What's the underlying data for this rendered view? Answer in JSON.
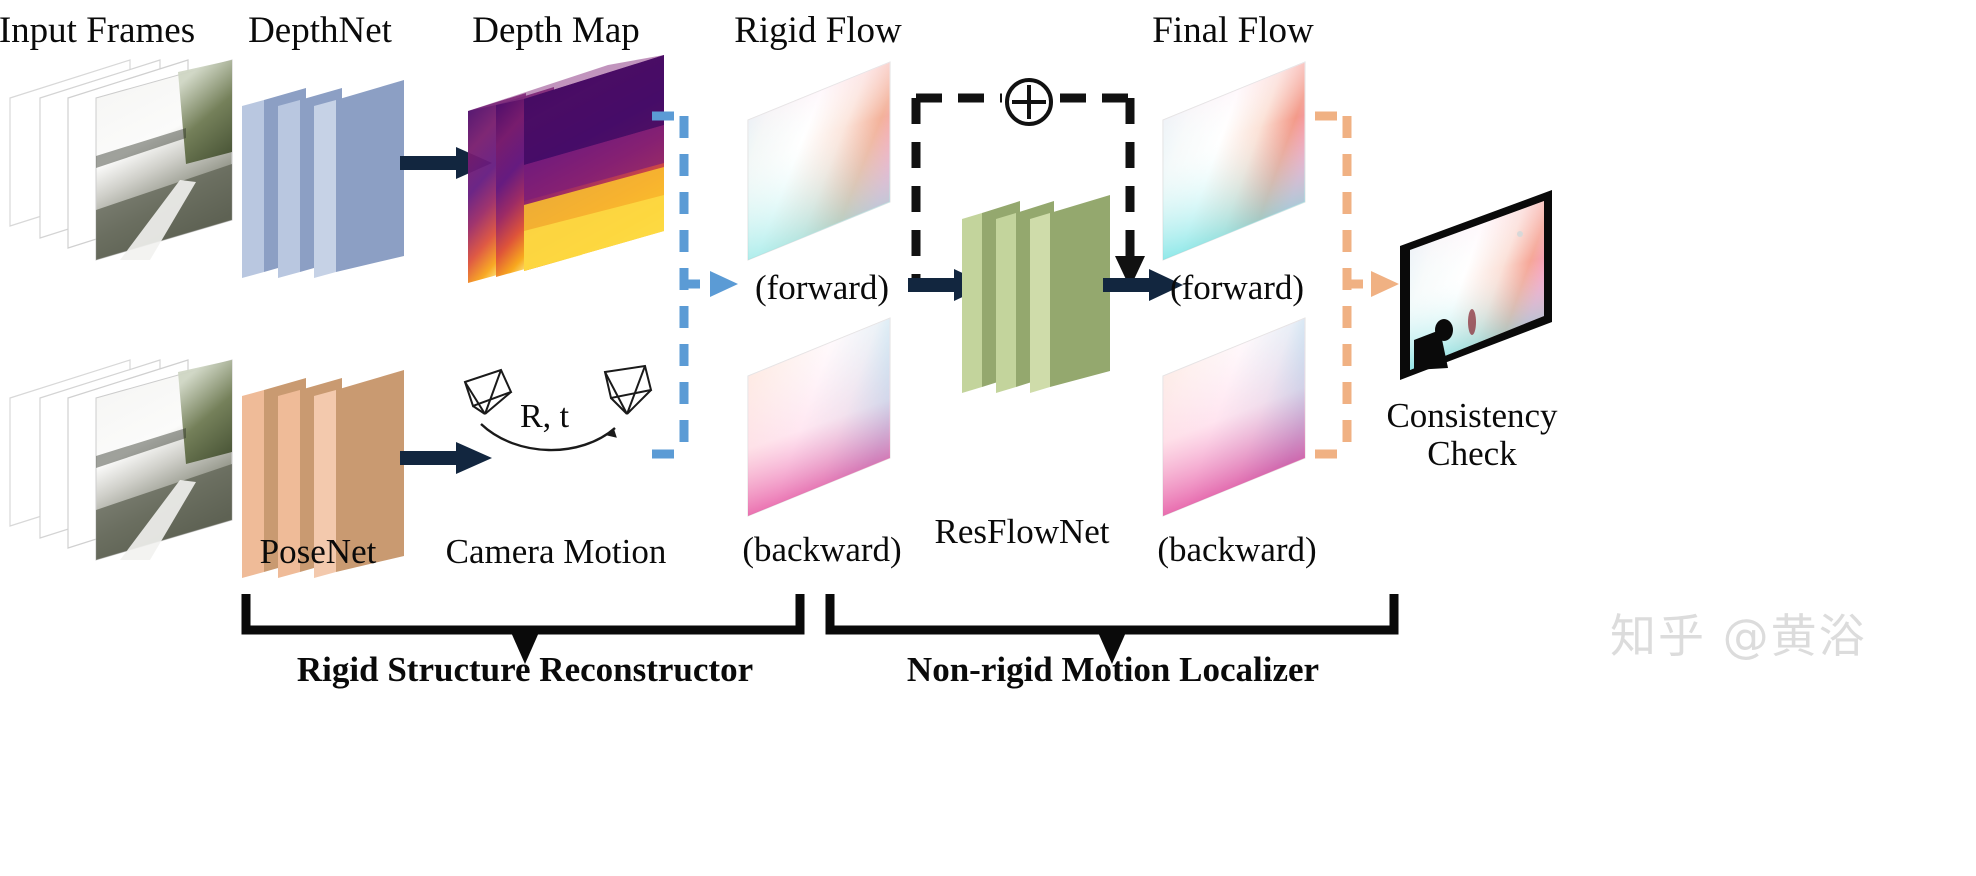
{
  "figure": {
    "title_labels": {
      "input_frames": "Input Frames",
      "depthnet": "DepthNet",
      "depth_map": "Depth Map",
      "rigid_flow": "Rigid Flow",
      "final_flow": "Final Flow"
    },
    "bottom_labels": {
      "posenet": "PoseNet",
      "camera_motion": "Camera Motion",
      "resflownet": "ResFlowNet"
    },
    "direction_labels": {
      "rigid_forward": "(forward)",
      "rigid_backward": "(backward)",
      "final_forward": "(forward)",
      "final_backward": "(backward)"
    },
    "consistency_check": {
      "line1": "Consistency",
      "line2": "Check"
    },
    "pose_params": "R, t",
    "operator_symbol": "⊕",
    "stage_labels": {
      "left": "Rigid Structure Reconstructor",
      "right": "Non-rigid Motion Localizer"
    },
    "watermark": "知乎 @黄浴",
    "colors": {
      "depthnet_slab": "#8c9fc4",
      "depthnet_edge": "#b9c7e0",
      "posenet_slab": "#c99a71",
      "posenet_edge": "#efbb98",
      "resflownet_slab": "#94a86e",
      "resflownet_edge": "#c3d49c",
      "arrow_dark": "#12263f",
      "dash_blue": "#5b9bd5",
      "dash_orange": "#f0b183",
      "dash_black": "#111111",
      "text": "#0a0a0a",
      "watermark": "#dcdcdc"
    }
  }
}
